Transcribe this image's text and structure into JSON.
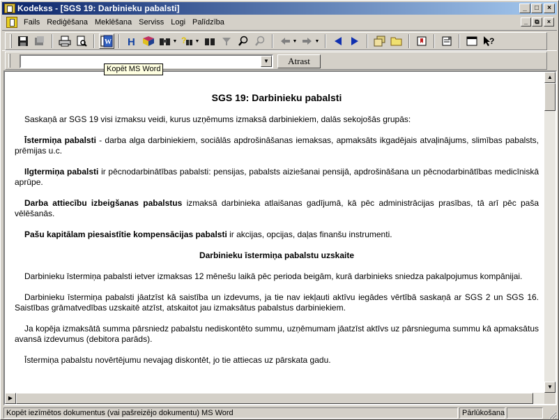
{
  "window": {
    "title": "Kodekss - [SGS 19: Darbinieku pabalsti]",
    "controls": [
      "_",
      "□",
      "×"
    ]
  },
  "menubar": {
    "items": [
      "Fails",
      "Rediģēšana",
      "Meklēšana",
      "Serviss",
      "Logi",
      "Palīdzība"
    ],
    "mdi_controls": [
      "_",
      "⧉",
      "×"
    ]
  },
  "toolbar": {
    "icons": [
      "save-icon",
      "floppy-icon",
      "print-icon",
      "print-preview-icon",
      "copy-to-word-icon",
      "heading-icon",
      "book-icon",
      "binoculars-icon",
      "help-search-icon",
      "binoculars-alt-icon",
      "filter-icon",
      "zoom-icon",
      "zoom-out-icon",
      "back-arrow-icon",
      "forward-arrow-icon",
      "prev-icon",
      "next-icon",
      "documents-icon",
      "folder-icon",
      "bookmark-icon",
      "properties-icon",
      "window-icon",
      "whats-this-icon"
    ]
  },
  "search": {
    "value": "",
    "placeholder": "",
    "button_label": "Atrast"
  },
  "tooltip": "Kopēt MS Word",
  "document": {
    "title": "SGS 19: Darbinieku pabalsti",
    "intro": "Saskaņā ar SGS 19 visi izmaksu veidi, kurus uzņēmums izmaksā darbiniekiem, dalās sekojošās grupās:",
    "groups": [
      {
        "term": "Īstermiņa pabalsti",
        "text": " - darba alga darbiniekiem, sociālās apdrošināšanas iemaksas, apmaksāts ikgadējais atvaļinājums, slimības pabalsts, prēmijas u.c."
      },
      {
        "term": "Ilgtermiņa pabalsti",
        "text": " ir pēcnodarbinātības pabalsti: pensijas, pabalsts aiziešanai pensijā, apdrošināšana un pēcnodarbinātības medicīniskā aprūpe."
      },
      {
        "term": "Darba attiecību izbeigšanas pabalstus",
        "text": " izmaksā darbinieka atlaišanas gadījumā, kā pēc administrācijas prasības, tā arī pēc paša vēlēšanās."
      },
      {
        "term": "Pašu kapitālam piesaistītie kompensācijas pabalsti",
        "text": " ir akcijas, opcijas, daļas finanšu instrumenti."
      }
    ],
    "section_heading": "Darbinieku īstermiņa pabalstu uzskaite",
    "paragraphs": [
      "Darbinieku īstermiņa pabalsti ietver izmaksas 12 mēnešu laikā pēc perioda beigām, kurā darbinieks sniedza pakalpojumus kompānijai.",
      "Darbinieku īstermiņa pabalsti jāatzīst kā saistība un izdevums, ja tie nav iekļauti aktīvu iegādes vērtībā saskaņā ar SGS 2 un SGS 16. Saistības grāmatvedības uzskaitē atzīst, atskaitot jau izmaksātus pabalstus darbiniekiem.",
      "Ja kopēja izmaksātā summa pārsniedz pabalstu nediskontēto summu, uzņēmumam jāatzīst aktīvs uz pārsnieguma summu kā apmaksātus avansā izdevumus (debitora parāds).",
      "Īstermiņa pabalstu novērtējumu nevajag diskontēt, jo tie attiecas uz pārskata gadu."
    ]
  },
  "statusbar": {
    "message": "Kopēt iezīmētos dokumentus (vai pašreizējo dokumentu) MS Word",
    "mode": "Pārlūkošana"
  }
}
